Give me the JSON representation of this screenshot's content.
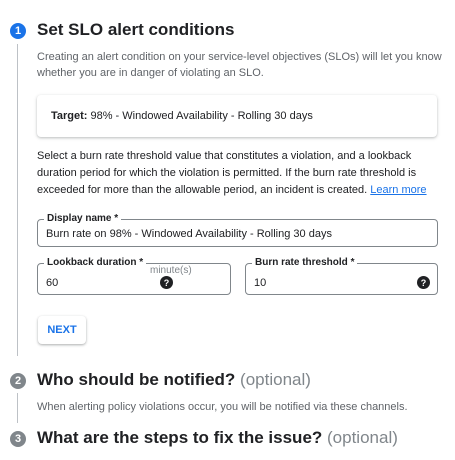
{
  "steps": [
    {
      "number": "1",
      "title": "Set SLO alert conditions",
      "optional": ""
    },
    {
      "number": "2",
      "title": "Who should be notified?",
      "optional": "(optional)"
    },
    {
      "number": "3",
      "title": "What are the steps to fix the issue?",
      "optional": "(optional)"
    }
  ],
  "step1": {
    "description": "Creating an alert condition on your service-level objectives (SLOs) will let you know whether you are in danger of violating an SLO.",
    "target_label": "Target:",
    "target_value": "98% - Windowed Availability - Rolling 30 days",
    "instructions": "Select a burn rate threshold value that constitutes a violation, and a lookback duration period for which the violation is permitted. If the burn rate threshold is exceeded for more than the allowable period, an incident is created.",
    "learn_more": "Learn more",
    "display_name": {
      "label": "Display name *",
      "value": "Burn rate on 98% - Windowed Availability - Rolling 30 days"
    },
    "lookback": {
      "label": "Lookback duration *",
      "value": "60",
      "unit": "minute(s)",
      "help_icon": "help-icon"
    },
    "burn_rate": {
      "label": "Burn rate threshold *",
      "value": "10",
      "help_icon": "help-icon"
    },
    "next_label": "NEXT"
  },
  "step2": {
    "description": "When alerting policy violations occur, you will be notified via these channels."
  },
  "colors": {
    "accent": "#1a73e8",
    "inactive_step": "#80868b"
  }
}
